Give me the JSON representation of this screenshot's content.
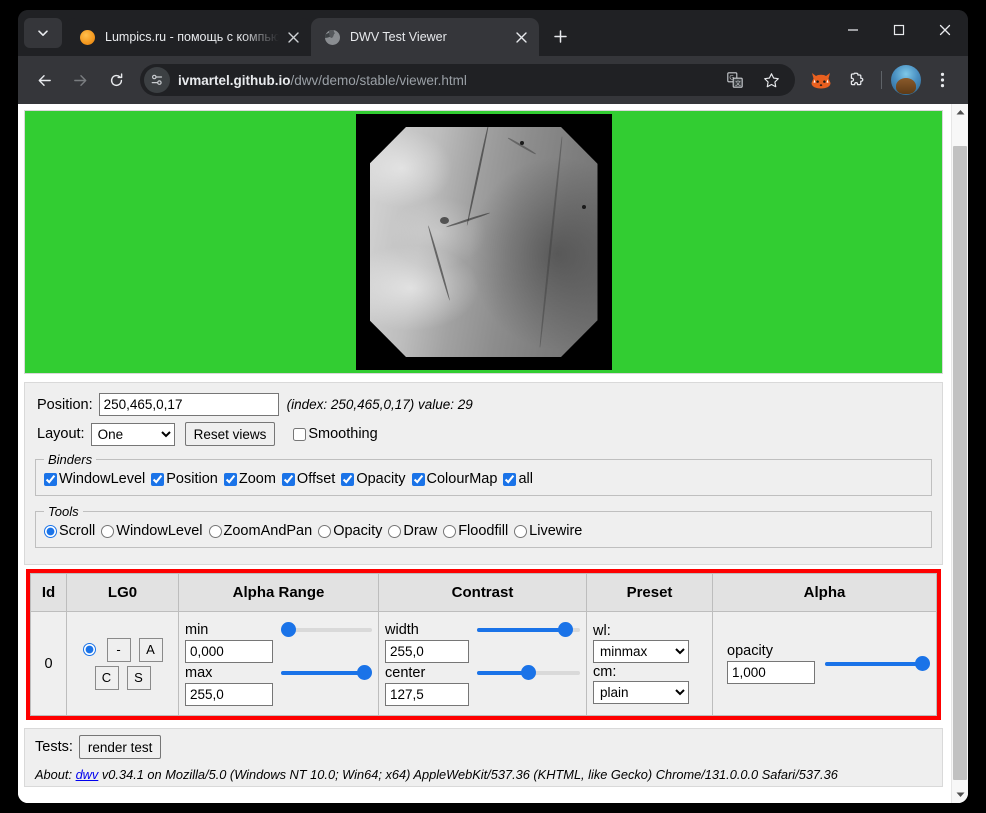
{
  "browser": {
    "tabs": [
      {
        "title": "Lumpics.ru - помощь с компьют",
        "favicon": "orange-circle-icon",
        "active": false
      },
      {
        "title": "DWV Test Viewer",
        "favicon": "globe-icon",
        "active": true
      }
    ],
    "newtab_label": "+",
    "window_controls": {
      "minimize": "minimize-icon",
      "maximize": "maximize-icon",
      "close": "close-icon"
    },
    "toolbar": {
      "back": "back-arrow-icon",
      "forward": "forward-arrow-icon",
      "reload": "reload-icon",
      "site_info": "site-settings-icon",
      "url_host": "ivmartel.github.io",
      "url_path": "/dwv/demo/stable/viewer.html",
      "translate": "translate-icon",
      "bookmark": "star-icon",
      "extension_fox": "fox-extension-icon",
      "extensions": "puzzle-icon",
      "profile": "profile-avatar-icon",
      "menu": "three-dot-menu-icon"
    }
  },
  "viewer": {
    "background_color": "#32cd32",
    "image_alt": "x-ray-angiography-image"
  },
  "controls": {
    "position_label": "Position:",
    "position_value": "250,465,0,17",
    "position_hint": "(index: 250,465,0,17) value: 29",
    "layout_label": "Layout:",
    "layout_value": "One",
    "layout_options": [
      "One"
    ],
    "reset_views_label": "Reset views",
    "smoothing_label": "Smoothing",
    "smoothing_checked": false
  },
  "binders": {
    "legend": "Binders",
    "items": [
      {
        "label": "WindowLevel",
        "checked": true
      },
      {
        "label": "Position",
        "checked": true
      },
      {
        "label": "Zoom",
        "checked": true
      },
      {
        "label": "Offset",
        "checked": true
      },
      {
        "label": "Opacity",
        "checked": true
      },
      {
        "label": "ColourMap",
        "checked": true
      },
      {
        "label": "all",
        "checked": true
      }
    ]
  },
  "tools": {
    "legend": "Tools",
    "items": [
      {
        "label": "Scroll",
        "selected": true
      },
      {
        "label": "WindowLevel",
        "selected": false
      },
      {
        "label": "ZoomAndPan",
        "selected": false
      },
      {
        "label": "Opacity",
        "selected": false
      },
      {
        "label": "Draw",
        "selected": false
      },
      {
        "label": "Floodfill",
        "selected": false
      },
      {
        "label": "Livewire",
        "selected": false
      }
    ]
  },
  "layer_table": {
    "highlight_color": "#fe0000",
    "headers": [
      "Id",
      "LG0",
      "Alpha Range",
      "Contrast",
      "Preset",
      "Alpha"
    ],
    "row": {
      "id": "0",
      "lg0": {
        "radio_selected": true,
        "buttons": [
          "-",
          "A",
          "C",
          "S"
        ]
      },
      "alpha_range": {
        "min_label": "min",
        "min_value": "0,000",
        "min_pct": 0,
        "max_label": "max",
        "max_value": "255,0",
        "max_pct": 100
      },
      "contrast": {
        "width_label": "width",
        "width_value": "255,0",
        "width_pct": 92,
        "center_label": "center",
        "center_value": "127,5",
        "center_pct": 50
      },
      "preset": {
        "wl_label": "wl:",
        "wl_value": "minmax",
        "wl_options": [
          "minmax"
        ],
        "cm_label": "cm:",
        "cm_value": "plain",
        "cm_options": [
          "plain"
        ]
      },
      "alpha": {
        "opacity_label": "opacity",
        "opacity_value": "1,000",
        "opacity_pct": 100
      }
    }
  },
  "footer": {
    "tests_label": "Tests:",
    "render_test_label": "render test",
    "about_prefix": "About:",
    "about_link": "dwv",
    "about_text": "v0.34.1 on Mozilla/5.0 (Windows NT 10.0; Win64; x64) AppleWebKit/537.36 (KHTML, like Gecko) Chrome/131.0.0.0 Safari/537.36"
  }
}
